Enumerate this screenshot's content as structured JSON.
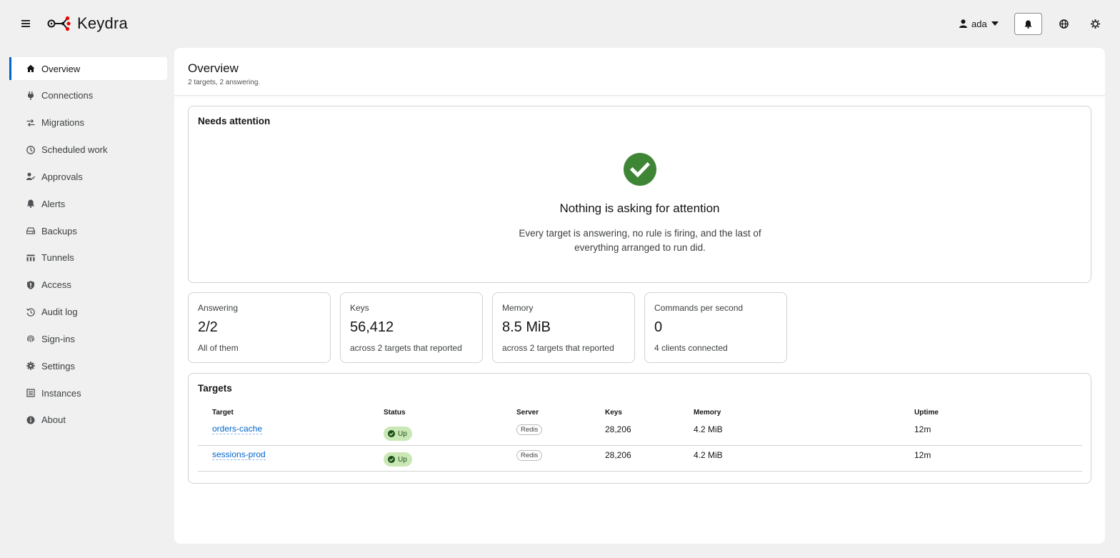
{
  "header": {
    "brand": "Keydra",
    "user": "ada",
    "icons": {
      "menu": "hamburger-icon",
      "user": "user-icon",
      "bell": "bell-icon",
      "globe": "globe-icon",
      "theme": "sun-gear-icon"
    }
  },
  "sidebar": {
    "items": [
      {
        "label": "Overview",
        "icon": "home-icon",
        "active": true
      },
      {
        "label": "Connections",
        "icon": "plug-icon"
      },
      {
        "label": "Migrations",
        "icon": "arrows-icon"
      },
      {
        "label": "Scheduled work",
        "icon": "clock-icon"
      },
      {
        "label": "Approvals",
        "icon": "user-check-icon"
      },
      {
        "label": "Alerts",
        "icon": "bell-icon"
      },
      {
        "label": "Backups",
        "icon": "drive-icon"
      },
      {
        "label": "Tunnels",
        "icon": "tunnel-icon"
      },
      {
        "label": "Access",
        "icon": "shield-icon"
      },
      {
        "label": "Audit log",
        "icon": "history-icon"
      },
      {
        "label": "Sign-ins",
        "icon": "fingerprint-icon"
      },
      {
        "label": "Settings",
        "icon": "gear-icon"
      },
      {
        "label": "Instances",
        "icon": "server-icon"
      },
      {
        "label": "About",
        "icon": "info-icon"
      }
    ]
  },
  "page": {
    "title": "Overview",
    "subtitle": "2 targets, 2 answering."
  },
  "attention": {
    "title": "Needs attention",
    "ok_title": "Nothing is asking for attention",
    "ok_text": "Every target is answering, no rule is firing, and the last of everything arranged to run did."
  },
  "stats": [
    {
      "label": "Answering",
      "value": "2/2",
      "foot": "All of them"
    },
    {
      "label": "Keys",
      "value": "56,412",
      "foot": "across 2 targets that reported"
    },
    {
      "label": "Memory",
      "value": "8.5 MiB",
      "foot": "across 2 targets that reported"
    },
    {
      "label": "Commands per second",
      "value": "0",
      "foot": "4 clients connected"
    }
  ],
  "targets": {
    "title": "Targets",
    "columns": [
      "Target",
      "Status",
      "Server",
      "Keys",
      "Memory",
      "Uptime"
    ],
    "rows": [
      {
        "target": "orders-cache",
        "status": "Up",
        "server": "Redis",
        "keys": "28,206",
        "memory": "4.2 MiB",
        "uptime": "12m"
      },
      {
        "target": "sessions-prod",
        "status": "Up",
        "server": "Redis",
        "keys": "28,206",
        "memory": "4.2 MiB",
        "uptime": "12m"
      }
    ]
  },
  "colors": {
    "accent": "#0066cc",
    "success": "#3e8635",
    "status_bg": "#c9e8b6"
  }
}
